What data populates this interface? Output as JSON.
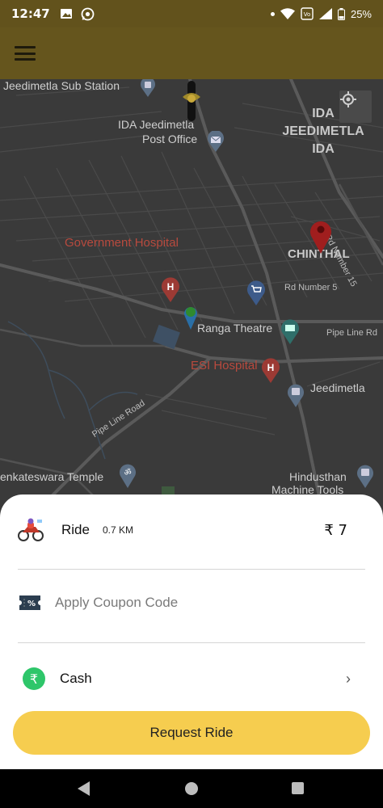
{
  "status_bar": {
    "time": "12:47",
    "battery": "25%",
    "icons": [
      "gallery-icon",
      "whatsapp-icon",
      "dot-icon",
      "wifi-icon",
      "volte-icon",
      "signal-icon",
      "battery-icon"
    ]
  },
  "app_bar": {
    "menu_icon": "hamburger-menu-icon"
  },
  "map": {
    "labels": {
      "substation": "Jeedimetla Sub Station",
      "post_office_1": "IDA Jeedimetla",
      "post_office_2": "Post Office",
      "ida_1": "IDA",
      "ida_2": "JEEDIMETLA",
      "ida_3": "IDA",
      "hospital": "Government Hospital",
      "chinthal": "CHINTHAL",
      "rd15": "Rd Number 15",
      "rd5": "Rd Number 5",
      "ranga": "Ranga Theatre",
      "pipeline_rd": "Pipe Line Rd",
      "esi": "ESI Hospital",
      "jeedimetla": "Jeedimetla",
      "pipeline_road": "Pipe Line Road",
      "temple": "enkateswara Temple",
      "hindusthan_1": "Hindusthan",
      "hindusthan_2": "Machine Tools"
    },
    "icons": [
      "my-location-icon",
      "bike-marker-icon",
      "destination-pin-icon",
      "pickup-pin-icon",
      "hospital-icon",
      "cart-icon",
      "cinema-icon",
      "post-office-icon",
      "temple-icon",
      "bus-stop-icon"
    ]
  },
  "ride": {
    "label": "Ride",
    "distance": "0.7 KM",
    "price": "₹ 7",
    "icon": "motorbike-icon"
  },
  "coupon": {
    "label": "Apply Coupon Code",
    "icon": "coupon-ticket-icon"
  },
  "payment": {
    "label": "Cash",
    "icon": "rupee-cash-icon",
    "chevron": "›"
  },
  "request_button": {
    "label": "Request Ride"
  },
  "colors": {
    "app_bar": "#65551d",
    "map_bg": "#3a3a3a",
    "button": "#f6cd4f",
    "cash_green": "#2ec66a",
    "pin_red": "#a01e1e"
  },
  "nav": {
    "icons": [
      "back-icon",
      "home-icon",
      "recents-icon"
    ]
  }
}
